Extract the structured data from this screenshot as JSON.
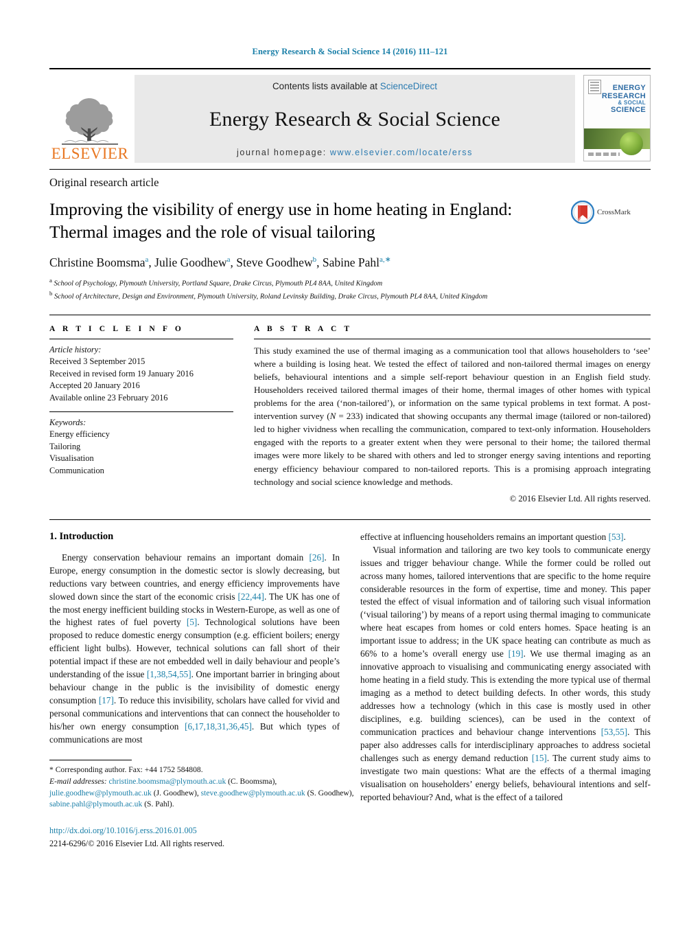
{
  "running_head": "Energy Research & Social Science 14 (2016) 111–121",
  "masthead": {
    "publisher": "ELSEVIER",
    "contents_prefix": "Contents lists available at ",
    "contents_link": "ScienceDirect",
    "journal_title": "Energy Research & Social Science",
    "homepage_prefix": "journal homepage: ",
    "homepage_url": "www.elsevier.com/locate/erss",
    "cover": {
      "line1": "ENERGY",
      "line2": "RESEARCH",
      "line3": "& SOCIAL",
      "line4": "SCIENCE"
    }
  },
  "article_type": "Original research article",
  "title": "Improving the visibility of energy use in home heating in England: Thermal images and the role of visual tailoring",
  "crossmark_label": "CrossMark",
  "authors_html": "Christine Boomsma<sup>a</sup>, Julie Goodhew<sup>a</sup>, Steve Goodhew<sup>b</sup>, Sabine Pahl<sup>a,∗</sup>",
  "affiliations": [
    "a School of Psychology, Plymouth University, Portland Square, Drake Circus, Plymouth PL4 8AA, United Kingdom",
    "b School of Architecture, Design and Environment, Plymouth University, Roland Levinsky Building, Drake Circus, Plymouth PL4 8AA, United Kingdom"
  ],
  "article_info": {
    "heading": "A R T I C L E   I N F O",
    "history_label": "Article history:",
    "history": [
      "Received 3 September 2015",
      "Received in revised form 19 January 2016",
      "Accepted 20 January 2016",
      "Available online 23 February 2016"
    ],
    "keywords_label": "Keywords:",
    "keywords": [
      "Energy efficiency",
      "Tailoring",
      "Visualisation",
      "Communication"
    ]
  },
  "abstract": {
    "heading": "A B S T R A C T",
    "text": "This study examined the use of thermal imaging as a communication tool that allows householders to ‘see’ where a building is losing heat. We tested the effect of tailored and non-tailored thermal images on energy beliefs, behavioural intentions and a simple self-report behaviour question in an English field study. Householders received tailored thermal images of their home, thermal images of other homes with typical problems for the area (‘non-tailored’), or information on the same typical problems in text format. A post-intervention survey (N = 233) indicated that showing occupants any thermal image (tailored or non-tailored) led to higher vividness when recalling the communication, compared to text-only information. Householders engaged with the reports to a greater extent when they were personal to their home; the tailored thermal images were more likely to be shared with others and led to stronger energy saving intentions and reporting energy efficiency behaviour compared to non-tailored reports. This is a promising approach integrating technology and social science knowledge and methods.",
    "copyright": "© 2016 Elsevier Ltd. All rights reserved."
  },
  "body": {
    "section_heading": "1.  Introduction",
    "left_paragraph_1": "Energy conservation behaviour remains an important domain [26]. In Europe, energy consumption in the domestic sector is slowly decreasing, but reductions vary between countries, and energy efficiency improvements have slowed down since the start of the economic crisis [22,44]. The UK has one of the most energy inefficient building stocks in Western-Europe, as well as one of the highest rates of fuel poverty [5]. Technological solutions have been proposed to reduce domestic energy consumption (e.g. efficient boilers; energy efficient light bulbs). However, technical solutions can fall short of their potential impact if these are not embedded well in daily behaviour and people’s understanding of the issue [1,38,54,55]. One important barrier in bringing about behaviour change in the public is the invisibility of domestic energy consumption [17]. To reduce this invisibility, scholars have called for vivid and personal communications and interventions that can connect the householder to his/her own energy consumption [6,17,18,31,36,45]. But which types of communications are most",
    "right_paragraph_1": "effective at influencing householders remains an important question [53].",
    "right_paragraph_2": "Visual information and tailoring are two key tools to communicate energy issues and trigger behaviour change. While the former could be rolled out across many homes, tailored interventions that are specific to the home require considerable resources in the form of expertise, time and money. This paper tested the effect of visual information and of tailoring such visual information (‘visual tailoring’) by means of a report using thermal imaging to communicate where heat escapes from homes or cold enters homes. Space heating is an important issue to address; in the UK space heating can contribute as much as 66% to a home’s overall energy use [19]. We use thermal imaging as an innovative approach to visualising and communicating energy associated with home heating in a field study. This is extending the more typical use of thermal imaging as a method to detect building defects. In other words, this study addresses how a technology (which in this case is mostly used in other disciplines, e.g. building sciences), can be used in the context of communication practices and behaviour change interventions [53,55]. This paper also addresses calls for interdisciplinary approaches to address societal challenges such as energy demand reduction [15]. The current study aims to investigate two main questions: What are the effects of a thermal imaging visualisation on householders’ energy beliefs, behavioural intentions and self-reported behaviour? And, what is the effect of a tailored"
  },
  "footnote": {
    "corresponding": "* Corresponding author. Fax: +44 1752 584808.",
    "email_label": "E-mail addresses:",
    "emails": [
      {
        "address": "christine.boomsma@plymouth.ac.uk",
        "owner": "(C. Boomsma),"
      },
      {
        "address": "julie.goodhew@plymouth.ac.uk",
        "owner": "(J. Goodhew),"
      },
      {
        "address": "steve.goodhew@plymouth.ac.uk",
        "owner": "(S. Goodhew),"
      },
      {
        "address": "sabine.pahl@plymouth.ac.uk",
        "owner": "(S. Pahl)."
      }
    ],
    "doi": "http://dx.doi.org/10.1016/j.erss.2016.01.005",
    "issn_line": "2214-6296/© 2016 Elsevier Ltd. All rights reserved."
  },
  "colors": {
    "link": "#1a7fa8",
    "elsevier_orange": "#E87722",
    "masthead_grey": "#e9e9e9"
  }
}
